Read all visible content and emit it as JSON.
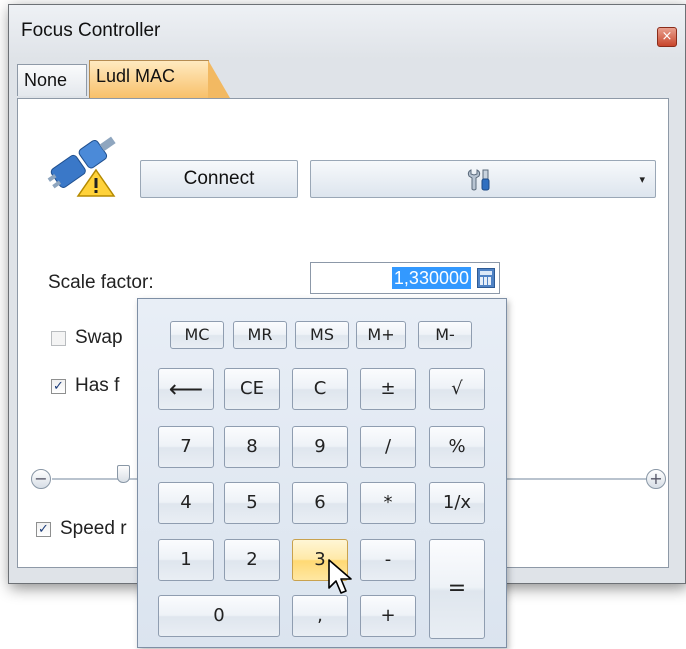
{
  "window": {
    "title": "Focus Controller",
    "close_glyph": "×"
  },
  "tabs": [
    {
      "label": "None",
      "active": false
    },
    {
      "label": "Ludl MAC",
      "active": true
    }
  ],
  "connection": {
    "status_icon": "plug-warning-icon",
    "connect_label": "Connect",
    "device_combo_icon": "tools-icon",
    "combo_arrow": "▾"
  },
  "scale": {
    "label": "Scale factor:",
    "value": "1,330000",
    "calc_icon": "calculator-icon"
  },
  "options": {
    "swap_label": "Swap",
    "swap_checked": false,
    "has_focus_label": "Has f",
    "has_focus_checked": true,
    "speed_label": "Speed r",
    "speed_checked": true,
    "check_glyph": "✓"
  },
  "slider": {
    "minus": "−",
    "plus": "+"
  },
  "calculator": {
    "memory": [
      "MC",
      "MR",
      "MS",
      "M+",
      "M-"
    ],
    "row1": [
      "⟵",
      "CE",
      "C",
      "±",
      "√"
    ],
    "row2": [
      "7",
      "8",
      "9",
      "/",
      "%"
    ],
    "row3": [
      "4",
      "5",
      "6",
      "*",
      "1/x"
    ],
    "row4": [
      "1",
      "2",
      "3",
      "-"
    ],
    "equals": "=",
    "row5": [
      "0",
      ",",
      "+"
    ],
    "hovered_key": "3"
  },
  "colors": {
    "active_tab": "#f8c06a",
    "selection": "#3399ff",
    "hover_key": "#ffd974"
  }
}
